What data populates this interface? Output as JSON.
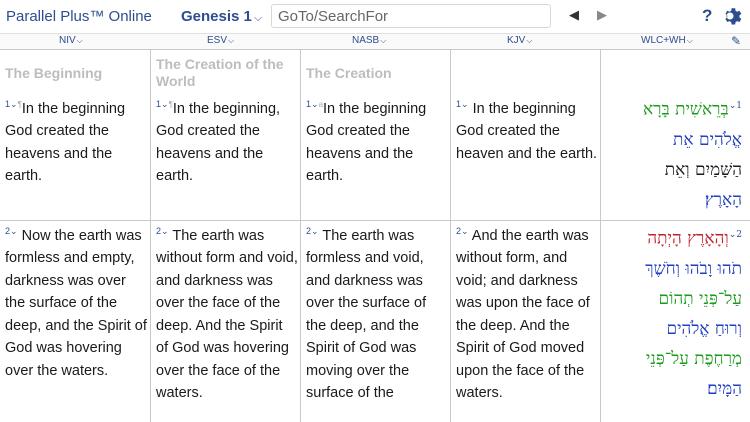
{
  "topbar": {
    "app_title": "Parallel Plus™ Online",
    "book_chapter": "Genesis 1",
    "search_placeholder": "GoTo/SearchFor",
    "help": "?"
  },
  "versions": [
    "NIV",
    "ESV",
    "NASB",
    "KJV",
    "WLC+WH"
  ],
  "columns": [
    {
      "heading": "The Beginning",
      "v1": {
        "num": "1",
        "text": "In the beginning God created the heavens and the earth."
      },
      "v2": {
        "num": "2",
        "text": "Now the earth was formless and empty, darkness was over the surface of the deep, and the Spirit of God was hovering over the waters."
      }
    },
    {
      "heading": "The Creation of the World",
      "v1": {
        "num": "1",
        "text": "In the beginning, God created the heavens and the earth."
      },
      "v2": {
        "num": "2",
        "text": "The earth was without form and void, and darkness was over the face of the deep. And the Spirit of God was hovering over the face of the waters."
      }
    },
    {
      "heading": "The Creation",
      "v1": {
        "num": "1",
        "text": "In the beginning God created the heavens and the earth."
      },
      "v2": {
        "num": "2",
        "text": "The earth was formless and void, and darkness was over the surface of the deep, and the Spirit of God was moving over the surface of the"
      }
    },
    {
      "heading": "",
      "v1": {
        "num": "1",
        "text": "In the beginning God created the heaven and the earth."
      },
      "v2": {
        "num": "2",
        "text": "And the earth was without form, and void; and darkness was upon the face of the deep. And the Spirit of God moved upon the face of the waters."
      }
    }
  ],
  "hebrew": {
    "v1_num": "1",
    "v1": [
      "בְּרֵאשִׁית בָּרָא",
      "אֱלֹהִים אֵת",
      "הַשָּׁמַיִם וְאֵת",
      "הָאָרֶץ׃"
    ],
    "v2_num": "2",
    "v2": [
      "וְהָאָרֶץ הָיְתָה",
      "תֹהוּ וָבֹהוּ וְחֹשֶׁךְ",
      "עַל־פְּנֵי תְהוֹם",
      "וְרוּחַ אֱלֹהִים",
      "מְרַחֶפֶת עַל־פְּנֵי",
      "הַמָּיִם׃"
    ],
    "colors": {
      "verb": "#1a9a1a",
      "noun": "#1f3fbf",
      "particle": "#c0202a",
      "article": "#7a3aa0"
    }
  }
}
